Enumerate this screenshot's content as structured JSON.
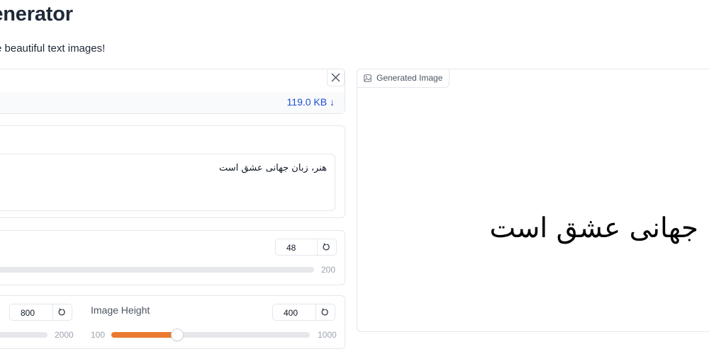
{
  "header": {
    "title": "Generator",
    "subtitle": "e beautiful text images!"
  },
  "file": {
    "size": "119.0 KB ↓"
  },
  "text_input": {
    "value": "هنر، زبان جهانی عشق است"
  },
  "font_size": {
    "value": "48",
    "max_label": "200",
    "level_fraction": null
  },
  "dimensions": {
    "width_value": "800",
    "width_max_label": "2000",
    "height_label": "Image Height",
    "height_value": "400",
    "height_min_label": "100",
    "height_max_label": "1000"
  },
  "output": {
    "tab_label": "Generated Image",
    "rendered_text": "ن جهانی عشق است"
  },
  "colors": {
    "accent": "#ea7a2f",
    "link": "#1d4ed8",
    "border": "#e5e7eb"
  },
  "icons": {
    "close": "close-icon",
    "reset": "reset-icon",
    "image": "image-icon",
    "download": "download-arrow"
  }
}
